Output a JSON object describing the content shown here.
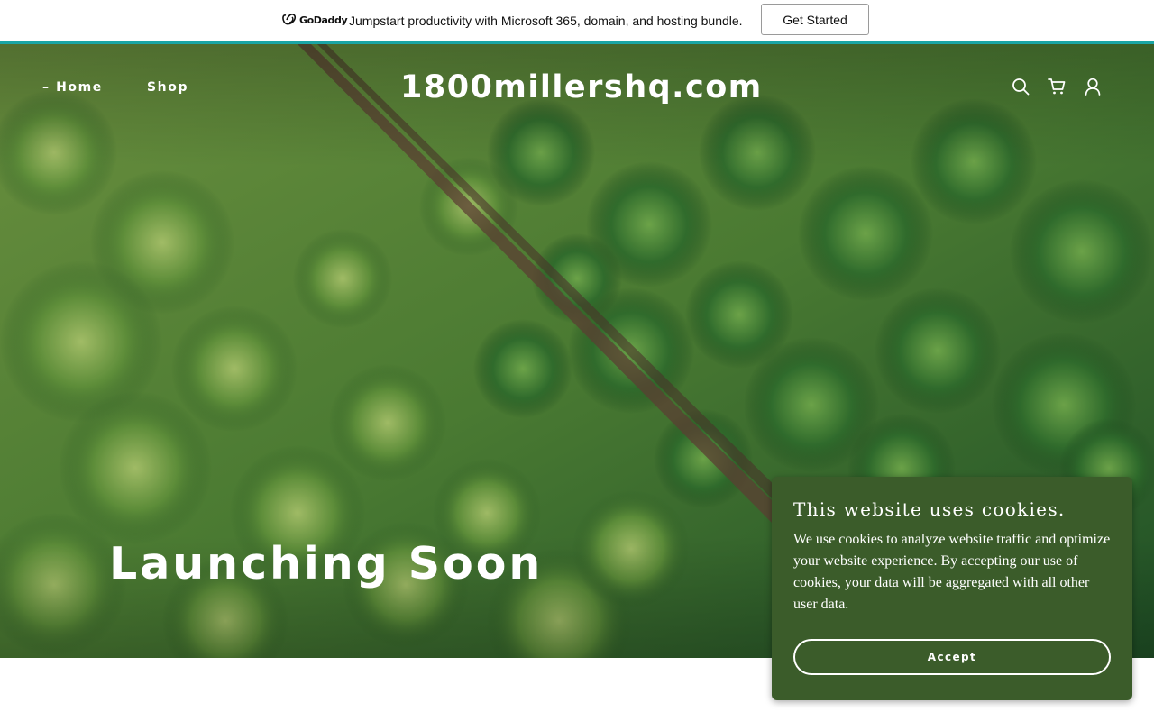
{
  "promo": {
    "logo_text": "GoDaddy",
    "message": "Jumpstart productivity with Microsoft 365, domain, and hosting bundle.",
    "cta_label": "Get Started",
    "accent_color": "#1aa5a5"
  },
  "header": {
    "nav": [
      {
        "label": "– Home"
      },
      {
        "label": "Shop"
      }
    ],
    "site_title": "1800millershq.com",
    "icons": [
      "search-icon",
      "cart-icon",
      "user-icon"
    ]
  },
  "hero": {
    "heading": "Launching Soon"
  },
  "cookie_banner": {
    "title": "This website uses cookies.",
    "body": "We use cookies to analyze website traffic and optimize your website experience. By accepting our use of cookies, your data will be aggregated with all other user data.",
    "accept_label": "Accept",
    "background_color": "#3b5c2a"
  }
}
